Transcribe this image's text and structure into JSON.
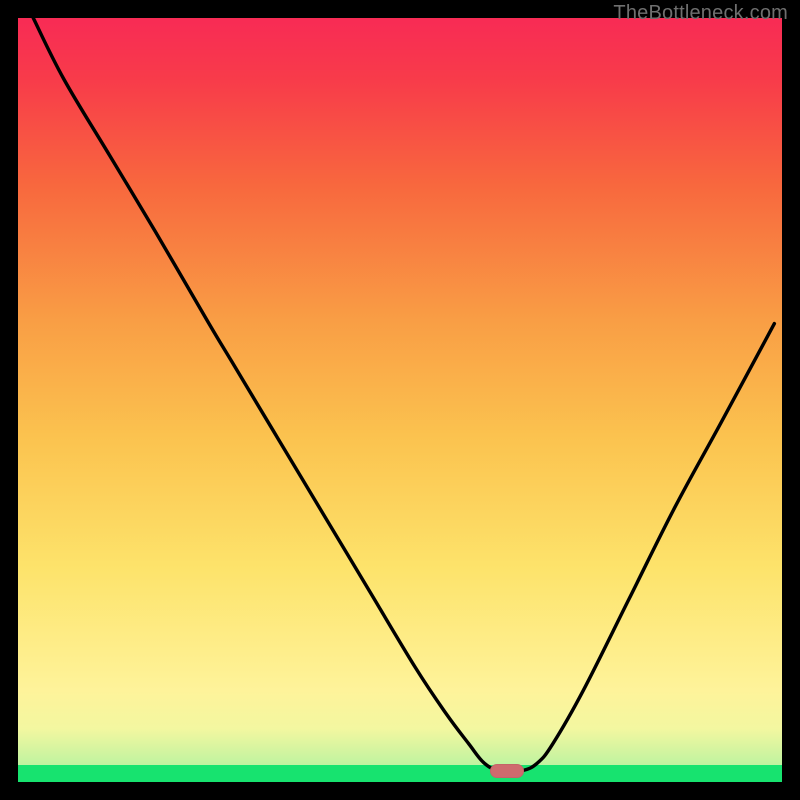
{
  "watermark": "TheBottleneck.com",
  "colors": {
    "frame": "#000000",
    "curve": "#000000",
    "marker": "#cf6a6e",
    "green": "#17e36f",
    "red_top": "#f82b55"
  },
  "chart_data": {
    "type": "line",
    "title": "",
    "xlabel": "",
    "ylabel": "",
    "xlim": [
      0,
      100
    ],
    "ylim": [
      0,
      100
    ],
    "legend": false,
    "grid": false,
    "annotations": [
      {
        "kind": "marker",
        "shape": "rounded-bar",
        "x": 64,
        "y": 1.5,
        "color": "#cf6a6e"
      }
    ],
    "series": [
      {
        "name": "bottleneck-curve",
        "color": "#000000",
        "x": [
          2,
          6,
          12,
          18,
          25,
          28,
          34,
          40,
          46,
          52,
          56,
          59,
          61,
          63,
          66,
          68,
          70,
          74,
          80,
          86,
          92,
          99
        ],
        "y": [
          100,
          92,
          82,
          72,
          60,
          55,
          45,
          35,
          25,
          15,
          9,
          5,
          2.5,
          1.5,
          1.5,
          2.5,
          5,
          12,
          24,
          36,
          47,
          60
        ]
      }
    ],
    "background_gradient_stops": [
      {
        "pos": 0.0,
        "color": "#17e36f"
      },
      {
        "pos": 0.022,
        "color": "#17e36f"
      },
      {
        "pos": 0.07,
        "color": "#f3f7a0"
      },
      {
        "pos": 0.28,
        "color": "#fde36b"
      },
      {
        "pos": 0.6,
        "color": "#f99f45"
      },
      {
        "pos": 0.92,
        "color": "#f83b4a"
      },
      {
        "pos": 1.0,
        "color": "#f82b55"
      }
    ]
  }
}
